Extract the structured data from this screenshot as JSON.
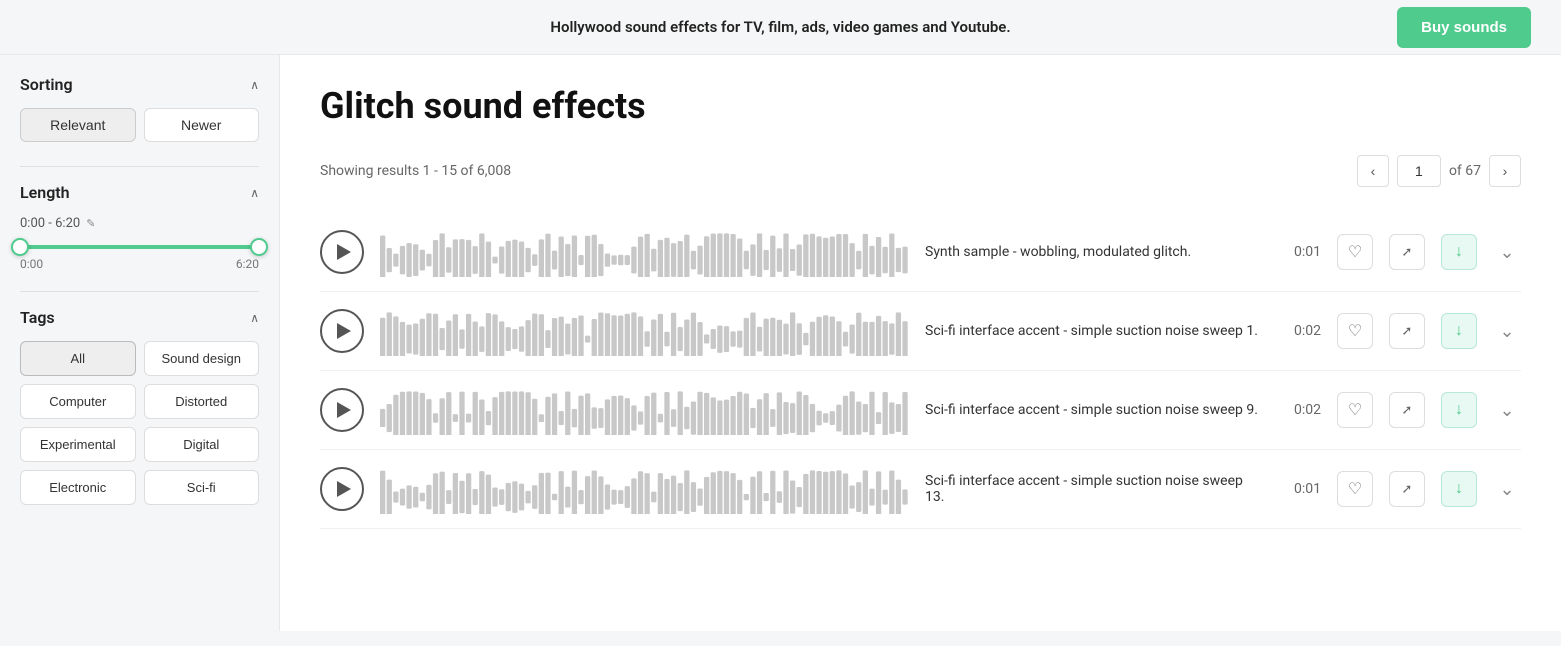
{
  "header": {
    "tagline": "Hollywood sound effects for TV, film, ads, video games and Youtube.",
    "buy_button_label": "Buy sounds"
  },
  "sidebar": {
    "sorting_label": "Sorting",
    "sort_buttons": [
      {
        "label": "Relevant",
        "active": true
      },
      {
        "label": "Newer",
        "active": false
      }
    ],
    "length_label": "Length",
    "length_range_display": "0:00 - 6:20",
    "length_range_min": "0:00",
    "length_range_max": "6:20",
    "tags_label": "Tags",
    "tags": [
      {
        "label": "All",
        "active": true
      },
      {
        "label": "Sound design",
        "active": false
      },
      {
        "label": "Computer",
        "active": false
      },
      {
        "label": "Distorted",
        "active": false
      },
      {
        "label": "Experimental",
        "active": false
      },
      {
        "label": "Digital",
        "active": false
      },
      {
        "label": "Electronic",
        "active": false
      },
      {
        "label": "Sci-fi",
        "active": false
      }
    ]
  },
  "main": {
    "page_title": "Glitch sound effects",
    "results_text": "Showing results 1 - 15 of 6,008",
    "page_current": "1",
    "page_of_label": "of 67",
    "sounds": [
      {
        "description": "Synth sample - wobbling, modulated glitch.",
        "duration": "0:01"
      },
      {
        "description": "Sci-fi interface accent - simple suction noise sweep 1.",
        "duration": "0:02"
      },
      {
        "description": "Sci-fi interface accent - simple suction noise sweep 9.",
        "duration": "0:02"
      },
      {
        "description": "Sci-fi interface accent - simple suction noise sweep 13.",
        "duration": "0:01"
      }
    ]
  },
  "icons": {
    "chevron_up": "∧",
    "chevron_left": "‹",
    "chevron_right": "›",
    "chevron_down": "∨",
    "heart": "♡",
    "share": "⤢",
    "download": "↓",
    "edit_pencil": "✎"
  }
}
